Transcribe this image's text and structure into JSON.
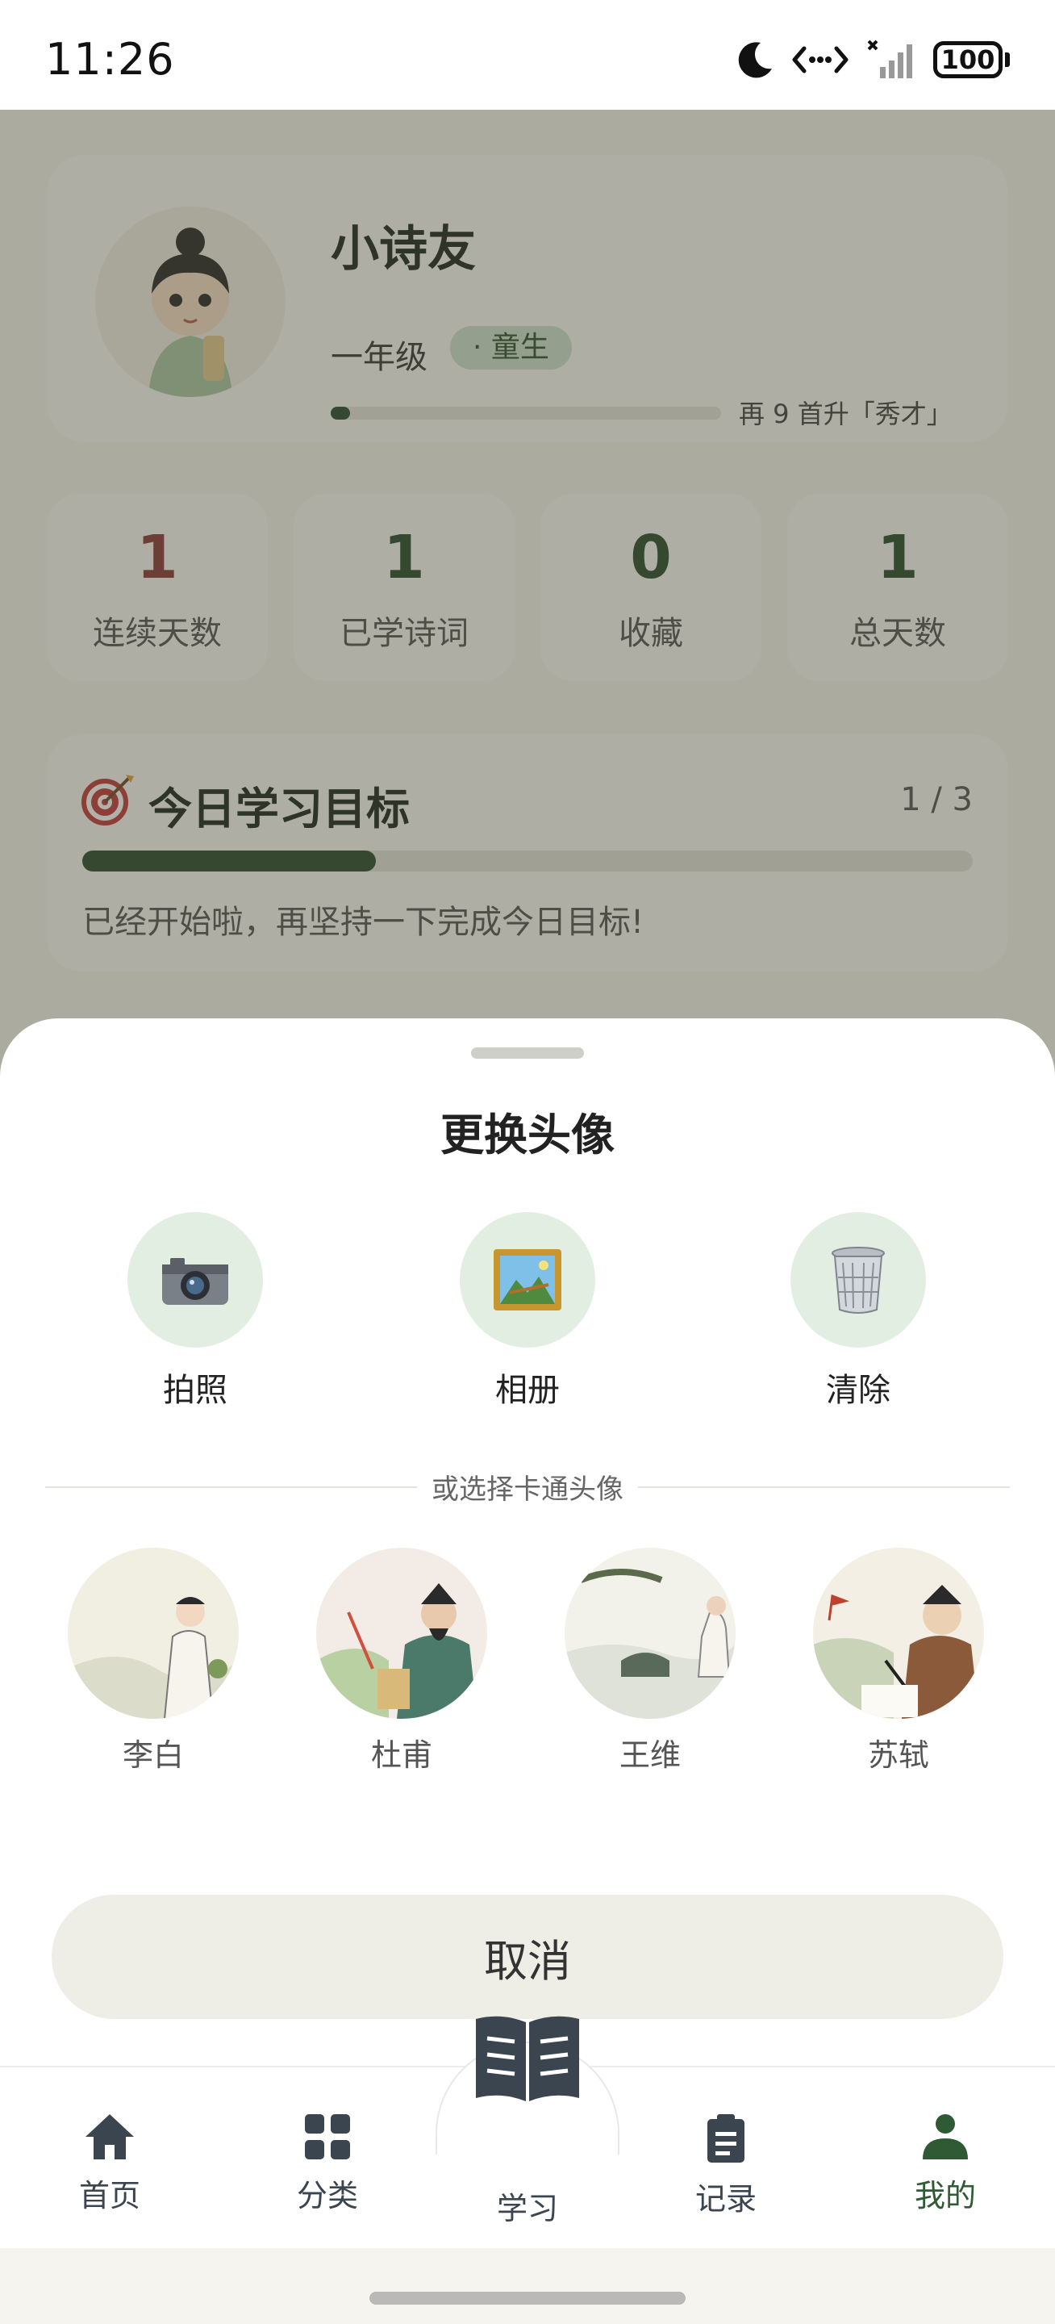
{
  "status_bar": {
    "time": "11:26",
    "battery": "100"
  },
  "profile": {
    "nickname": "小诗友",
    "grade": "一年级",
    "rank_badge": "· 童生",
    "level_progress": 0.05,
    "level_tip": "再 9 首升「秀才」"
  },
  "stats": [
    {
      "value": "1",
      "label": "连续天数",
      "color": "#8a3a3a"
    },
    {
      "value": "1",
      "label": "已学诗词",
      "color": "#2a4a30"
    },
    {
      "value": "0",
      "label": "收藏",
      "color": "#2a4a30"
    },
    {
      "value": "1",
      "label": "总天数",
      "color": "#2a4a30"
    }
  ],
  "goal": {
    "icon": "target-icon",
    "title": "今日学习目标",
    "count": "1 / 3",
    "progress": 0.33,
    "message": "已经开始啦，再坚持一下完成今日目标!"
  },
  "sheet": {
    "title": "更换头像",
    "actions": [
      {
        "label": "拍照",
        "icon": "camera-icon"
      },
      {
        "label": "相册",
        "icon": "picture-icon"
      },
      {
        "label": "清除",
        "icon": "trash-icon"
      }
    ],
    "divider_text": "或选择卡通头像",
    "avatars": [
      {
        "name": "李白"
      },
      {
        "name": "杜甫"
      },
      {
        "name": "王维"
      },
      {
        "name": "苏轼"
      }
    ],
    "cancel": "取消"
  },
  "tabs": [
    {
      "label": "首页",
      "icon": "home-icon"
    },
    {
      "label": "分类",
      "icon": "grid-icon"
    },
    {
      "label": "学习",
      "icon": "book-icon"
    },
    {
      "label": "记录",
      "icon": "clipboard-icon"
    },
    {
      "label": "我的",
      "icon": "user-icon",
      "active": true
    }
  ],
  "colors": {
    "accent": "#2e4a33",
    "active_tab": "#2f5a34"
  }
}
